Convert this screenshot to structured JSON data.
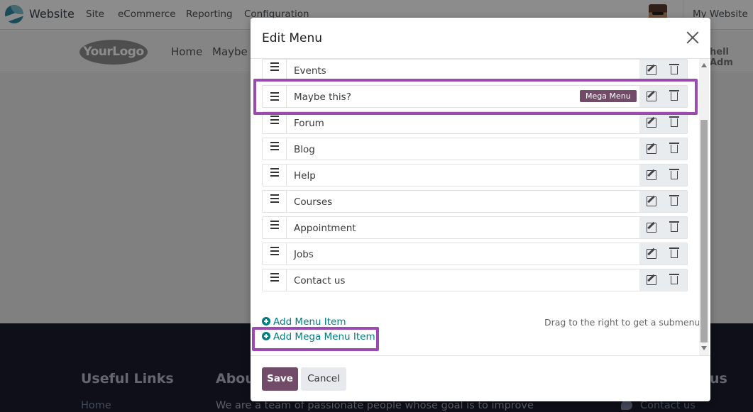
{
  "topbar": {
    "brand": "Website",
    "nav": [
      "Site",
      "eCommerce",
      "Reporting",
      "Configuration"
    ],
    "right_menu": "My Website"
  },
  "site": {
    "logo_text": "YourLogo",
    "nav": [
      "Home",
      "Maybe"
    ],
    "user_fragment": "hell Adm"
  },
  "footer": {
    "useful_links_heading": "Useful Links",
    "about_heading": "Abou",
    "right_heading_fragment": "us",
    "home_link": "Home",
    "about_text": "We are a team of passionate people whose goal is to improve",
    "contact_link": "Contact us"
  },
  "modal": {
    "title": "Edit Menu",
    "items": [
      {
        "label": "Events"
      },
      {
        "label": "Maybe this?",
        "badge": "Mega Menu"
      },
      {
        "label": "Forum"
      },
      {
        "label": "Blog"
      },
      {
        "label": "Help"
      },
      {
        "label": "Courses"
      },
      {
        "label": "Appointment"
      },
      {
        "label": "Jobs"
      },
      {
        "label": "Contact us"
      }
    ],
    "add_menu_item": "Add Menu Item",
    "add_mega_menu_item": "Add Mega Menu Item",
    "hint": "Drag to the right to get a submenu",
    "save_label": "Save",
    "cancel_label": "Cancel"
  },
  "colors": {
    "primary": "#714b67",
    "link": "#017e84",
    "highlight": "#9b4bb0",
    "footer_bg": "#1b1d2d"
  }
}
